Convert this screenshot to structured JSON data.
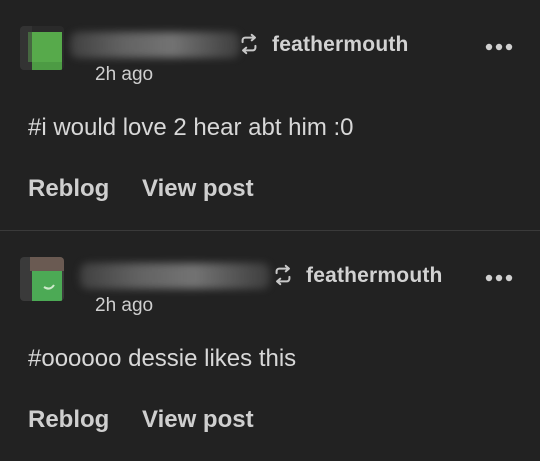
{
  "notes": [
    {
      "username": "feathermouth",
      "time": "2h ago",
      "tags": "#i would love 2 hear abt him :0",
      "actions": {
        "reblog": "Reblog",
        "view_post": "View post"
      },
      "avatar_colors": [
        "#55a84a",
        "#3e8e3a"
      ]
    },
    {
      "username": "feathermouth",
      "time": "2h ago",
      "tags": "#oooooo dessie likes this",
      "actions": {
        "reblog": "Reblog",
        "view_post": "View post"
      },
      "avatar_colors": [
        "#6a5a52",
        "#4caa55"
      ]
    }
  ],
  "icons": {
    "reblog": "reblog-icon",
    "more": "more-options-icon"
  }
}
